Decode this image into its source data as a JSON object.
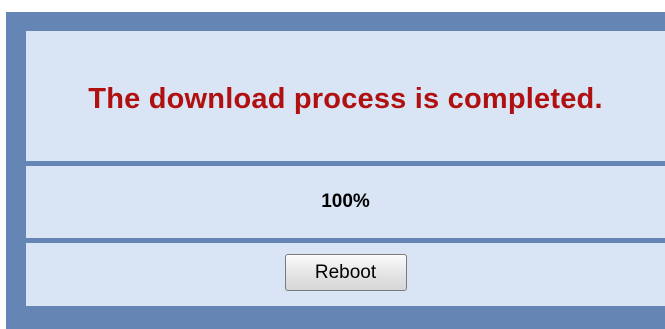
{
  "status": {
    "message": "The download process is completed.",
    "progress_text": "100%"
  },
  "actions": {
    "reboot_label": "Reboot"
  },
  "colors": {
    "frame": "#6585b4",
    "panel": "#d9e4f5",
    "message_text": "#b01010"
  }
}
